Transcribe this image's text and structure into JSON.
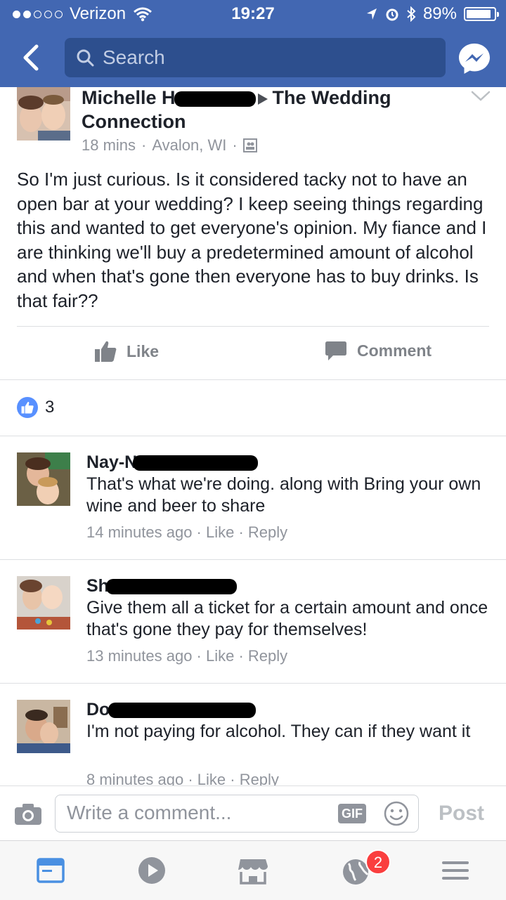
{
  "status_bar": {
    "carrier": "Verizon",
    "time": "19:27",
    "battery": "89%",
    "battery_level": 0.89,
    "signal_bars_filled": 2,
    "signal_bars_total": 5
  },
  "nav": {
    "search_placeholder": "Search"
  },
  "post": {
    "author_first": "Michelle H",
    "group_name": "The Wedding Connection",
    "time": "18 mins",
    "location": "Avalon, WI",
    "text": "So I'm just curious. Is it considered tacky not to have an open bar at your wedding? I keep seeing things regarding this and wanted to get everyone's opinion. My fiance and I are thinking we'll buy a predetermined amount of alcohol and when that's gone then everyone has to buy drinks. Is that fair??",
    "like_label": "Like",
    "comment_label": "Comment",
    "reaction_count": "3"
  },
  "comments": [
    {
      "name": "Nay-N",
      "text": "That's what we're doing. along with Bring your own wine and beer to share",
      "time": "14 minutes ago",
      "like_label": "Like",
      "reply_label": "Reply"
    },
    {
      "name": "Sh",
      "text": "Give them all a ticket for a certain amount and once that's gone they pay for themselves!",
      "time": "13 minutes ago",
      "like_label": "Like",
      "reply_label": "Reply"
    },
    {
      "name": "Do",
      "text": "I'm not paying for alcohol. They can if they want it",
      "time": "8 minutes ago",
      "like_label": "Like",
      "reply_label": "Reply"
    }
  ],
  "composer": {
    "placeholder": "Write a comment...",
    "gif_label": "GIF",
    "post_label": "Post"
  },
  "tabbar": {
    "notifications_badge": "2"
  },
  "colors": {
    "brand": "#4267b2",
    "search_bg": "#2d4f8e",
    "active_tab": "#4a90e2",
    "badge": "#fa3e3e"
  }
}
